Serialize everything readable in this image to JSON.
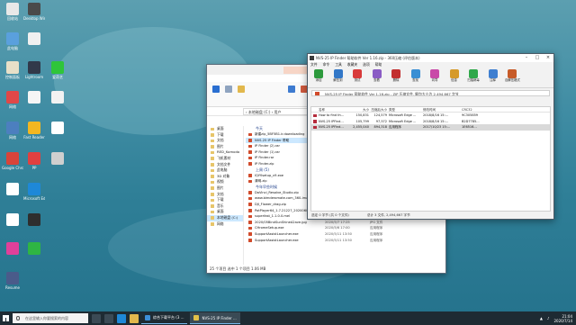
{
  "desktop": {
    "icons": [
      {
        "label": "回收站",
        "color": "#e8e8e8"
      },
      {
        "label": "Desktop Window Manager",
        "color": "#4a4a4a"
      },
      {
        "label": "此电脑",
        "color": "#5aa0dd"
      },
      {
        "label": "",
        "color": "#f0f0f0"
      },
      {
        "label": "控制面板",
        "color": "#e8e0c8"
      },
      {
        "label": "Lightroom",
        "color": "#31394a"
      },
      {
        "label": "爱奇艺",
        "color": "#2fc53a"
      },
      {
        "label": "网络",
        "color": "#e04848"
      },
      {
        "label": "",
        "color": "#f5f5f5"
      },
      {
        "label": "",
        "color": "#f2f2f2"
      },
      {
        "label": "网络",
        "color": "#4c7fbf"
      },
      {
        "label": "Fast Reader",
        "color": "#f3b721"
      },
      {
        "label": "",
        "color": "#ffffff"
      },
      {
        "label": "Google Chrome",
        "color": "#d8443a"
      },
      {
        "label": "PP",
        "color": "#e04040"
      },
      {
        "label": "",
        "color": "#cfcfcf"
      },
      {
        "label": "",
        "color": "#ffffff"
      },
      {
        "label": "Microsoft Edge",
        "color": "#1e88d8"
      },
      {
        "label": "",
        "color": "#ffffff"
      },
      {
        "label": "",
        "color": "#2e2e2e"
      },
      {
        "label": "",
        "color": "#e0409a"
      },
      {
        "label": "",
        "color": "#2fb543"
      },
      {
        "label": "Resume",
        "color": "#4a5b8a"
      }
    ]
  },
  "explorer": {
    "address": "› 本地磁盘 (C:) › 用户",
    "nav": [
      "桌面",
      "下载",
      "文档",
      "图片",
      "RED_Komodo",
      "飞机素材",
      "文档文件",
      "此电脑",
      "3D 对象",
      "视频",
      "图片",
      "文档",
      "下载",
      "音乐",
      "桌面",
      "本地磁盘 (C:)",
      "网络"
    ],
    "nav_selected_index": 15,
    "groups": [
      "今天",
      "上周 (5)",
      "今年早些时候"
    ],
    "files": [
      {
        "name": "新建zip_5BF5B1.ir.downloading",
        "date": "",
        "type": "",
        "size": "",
        "selected": false
      },
      {
        "name": "NVS-25 IP Finder 帮助",
        "date": "",
        "type": "",
        "size": "",
        "selected": true
      },
      {
        "name": "IP Finder (2).rar",
        "date": "",
        "type": "",
        "size": "",
        "selected": false
      },
      {
        "name": "IP Finder (1).rar",
        "date": "",
        "type": "",
        "size": "",
        "selected": false
      },
      {
        "name": "IP Finder.rar",
        "date": "",
        "type": "",
        "size": "",
        "selected": false
      },
      {
        "name": "IP Finder.zip",
        "date": "",
        "type": "",
        "size": "",
        "selected": false
      },
      {
        "name": "IQIYIsetup_v9.exe",
        "date": "",
        "type": "",
        "size": "",
        "selected": false
      },
      {
        "name": "清明.zip",
        "date": "",
        "type": "",
        "size": "",
        "selected": false
      },
      {
        "name": "DaVinci_Resolve_Studio.zip",
        "date": "2020/6/28 17:28",
        "type": "",
        "size": "",
        "selected": false
      },
      {
        "name": "www.bimderomate.com_360-image...",
        "date": "2020/6/15 17:41",
        "type": "",
        "size": "",
        "selected": false
      },
      {
        "name": "DJI_Flower_drag.zip",
        "date": "2020/6/15 16:21",
        "type": "",
        "size": "",
        "selected": false
      },
      {
        "name": "PotPlayer64_1.7.21227_20200609.7z",
        "date": "2020/6/9 17:20",
        "type": "360压缩 7Z 文件",
        "size": "",
        "selected": false
      },
      {
        "name": "superfast_1.1.0.0.mel",
        "date": "2020/6/1 13:30",
        "type": "",
        "size": "",
        "selected": false
      },
      {
        "name": "2020/05BindSunShineA2ave.jpg",
        "date": "2020/5/7 17:25",
        "type": "JPG 文件",
        "size": "",
        "selected": false
      },
      {
        "name": "CHromeSetup.exe",
        "date": "2020/5/6 17:00",
        "type": "应用程序",
        "size": "",
        "selected": false
      },
      {
        "name": "SupportAssistLauncher.exe",
        "date": "2020/5/11 13:50",
        "type": "应用程序",
        "size": "",
        "selected": false
      },
      {
        "name": "SupportAssistLauncher.exe",
        "date": "2020/5/11 13:50",
        "type": "应用程序",
        "size": "",
        "selected": false
      }
    ],
    "status": "25 个项目  选中 1 个项目  1.06 MB"
  },
  "zip": {
    "title": "NVS-25 IP Finder 帮助软件 Ver 1.16.zip - 360压缩 (评估版本)",
    "menu": [
      "文件",
      "命令",
      "工具",
      "收藏夹",
      "选项",
      "帮助"
    ],
    "toolbar": [
      {
        "label": "添加",
        "color": "#2d9a3d"
      },
      {
        "label": "解压到",
        "color": "#3277c7"
      },
      {
        "label": "测试",
        "color": "#d83a3a"
      },
      {
        "label": "查看",
        "color": "#8a5cc4"
      },
      {
        "label": "删除",
        "color": "#c23030"
      },
      {
        "label": "查找",
        "color": "#3a8fd4"
      },
      {
        "label": "向导",
        "color": "#c94aa8"
      },
      {
        "label": "信息",
        "color": "#d69a2a"
      },
      {
        "label": "扫描病毒",
        "color": "#2fa84a"
      },
      {
        "label": "注释",
        "color": "#3f7fd0"
      },
      {
        "label": "自解压格式",
        "color": "#c75b28"
      }
    ],
    "path": "NVS-25 IP Finder 帮助软件 Ver 1.16.zip - ZIP 压缩文件, 解包大小为 2,494,667 字节",
    "columns": [
      "名称",
      "大小",
      "压缩后大小",
      "类型",
      "修改时间",
      "CRC32"
    ],
    "rows": [
      {
        "name": "How to find th...",
        "size": "150,831",
        "packed": "124,579",
        "type": "Microsoft Edge ...",
        "modified": "2018/8/16 15:...",
        "crc": "9C305859",
        "selected": false
      },
      {
        "name": "NVS-25 IPFind...",
        "size": "105,799",
        "packed": "97,572",
        "type": "Microsoft Edge ...",
        "modified": "2018/8/16 15:...",
        "crc": "B2D7785...",
        "selected": false
      },
      {
        "name": "NVS-25 IPFind...",
        "size": "2,455,040",
        "packed": "894,318",
        "type": "应用程序",
        "modified": "2017/10/23 15:...",
        "crc": "1E6516...",
        "selected": true
      }
    ],
    "status_left": "选定 0 字节 (共 0 个文件)",
    "status_right": "总计 3 文件, 2,494,667 字节"
  },
  "taskbar": {
    "search_placeholder": "在这里输入你要搜索的内容",
    "apps": [
      {
        "label": "综合下载平台 (3 ...",
        "color": "#3c8fd8",
        "active": false
      },
      {
        "label": "NVS-25 IP Finder ...",
        "color": "#e2c048",
        "active": true
      }
    ],
    "time": "21:04",
    "date": "2020/7/14"
  }
}
